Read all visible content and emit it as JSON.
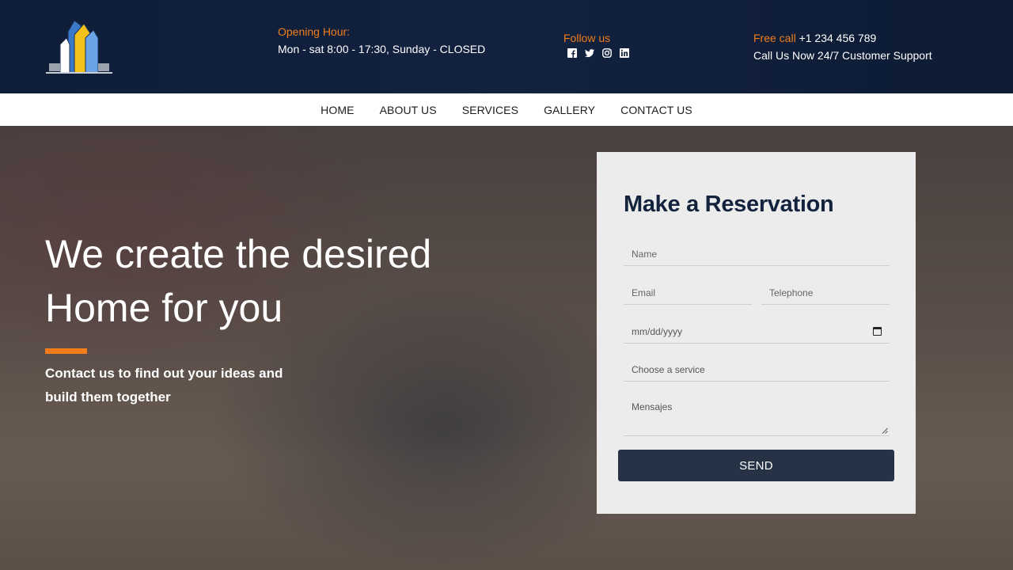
{
  "header": {
    "logo_icon": "building-logo-icon",
    "hours_label": "Opening Hour:",
    "hours_value": "Mon - sat 8:00 - 17:30, Sunday - CLOSED",
    "follow_label": "Follow us",
    "social_icons": [
      "facebook-icon",
      "twitter-icon",
      "instagram-icon",
      "linkedin-icon"
    ],
    "call_label": "Free call",
    "call_number": "+1 234 456 789",
    "call_sub": "Call Us Now 24/7 Customer Support"
  },
  "nav": {
    "items": [
      "HOME",
      "ABOUT US",
      "SERVICES",
      "GALLERY",
      "CONTACT US"
    ]
  },
  "hero": {
    "title_line1": "We create the desired",
    "title_line2": "Home for you",
    "subtitle": "Contact us to find out your ideas and build them together"
  },
  "form": {
    "title": "Make a Reservation",
    "name_placeholder": "Name",
    "email_placeholder": "Email",
    "telephone_placeholder": "Telephone",
    "date_placeholder": "mm/dd/yyyy",
    "service_placeholder": "Choose a service",
    "message_placeholder": "Mensajes",
    "send_label": "SEND"
  },
  "colors": {
    "accent": "#f07d19",
    "navy": "#13223d",
    "button": "#263246"
  }
}
